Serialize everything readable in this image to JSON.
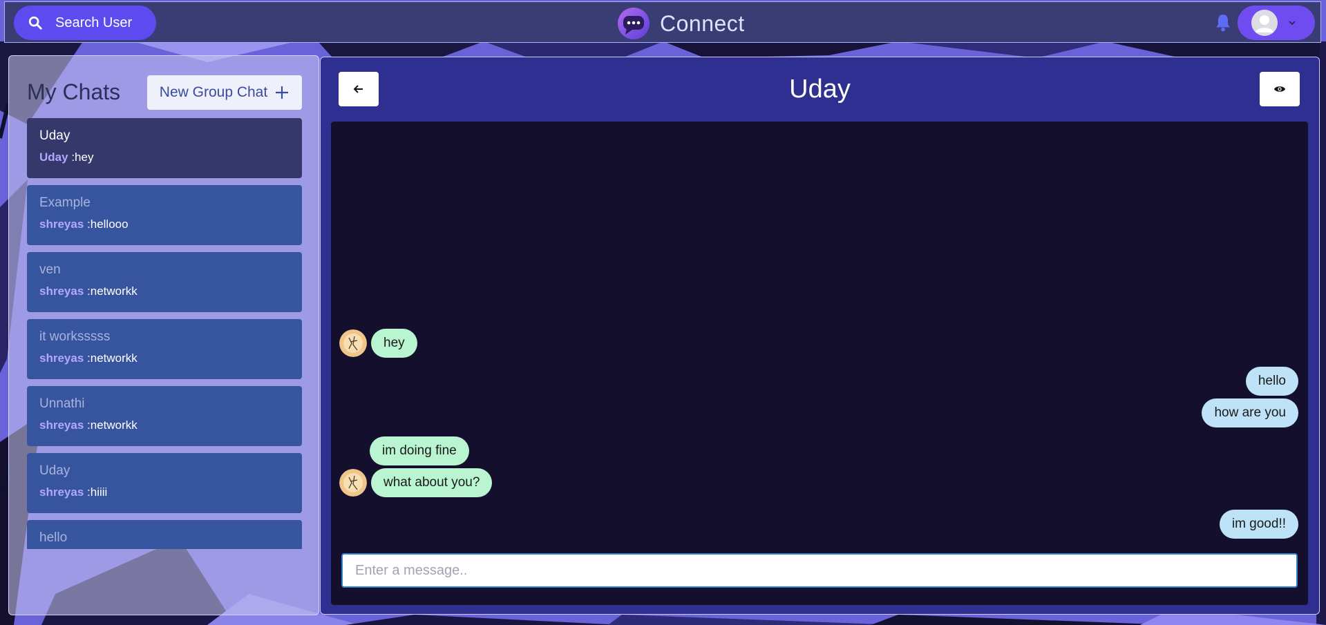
{
  "header": {
    "search_label": "Search User",
    "brand_name": "Connect"
  },
  "sidebar": {
    "title": "My Chats",
    "new_group_label": "New Group Chat",
    "chats": [
      {
        "name": "Uday",
        "sender": "Uday",
        "latest": ":hey",
        "active": true
      },
      {
        "name": "Example",
        "sender": "shreyas",
        "latest": ":hellooo",
        "active": false
      },
      {
        "name": "ven",
        "sender": "shreyas",
        "latest": ":networkk",
        "active": false
      },
      {
        "name": "it worksssss",
        "sender": "shreyas",
        "latest": ":networkk",
        "active": false
      },
      {
        "name": "Unnathi",
        "sender": "shreyas",
        "latest": ":networkk",
        "active": false
      },
      {
        "name": "Uday",
        "sender": "shreyas",
        "latest": ":hiiii",
        "active": false
      },
      {
        "name": "hello",
        "sender": "",
        "latest": "",
        "active": false
      }
    ]
  },
  "chat": {
    "title": "Uday",
    "messages": [
      {
        "text": "hey",
        "from": "them",
        "avatar": true
      },
      {
        "text": "hello",
        "from": "me",
        "avatar": false
      },
      {
        "text": "how are you",
        "from": "me",
        "avatar": false
      },
      {
        "text": "im doing fine",
        "from": "them",
        "avatar": false
      },
      {
        "text": "what about you?",
        "from": "them",
        "avatar": true
      },
      {
        "text": "im good!!",
        "from": "me",
        "avatar": false
      }
    ],
    "input_placeholder": "Enter a message.."
  },
  "colors": {
    "topbar": "#3a3d74",
    "accent": "#5d4bf0",
    "chat_panel": "#2f2f92",
    "messages_bg": "#150f2e",
    "bubble_them": "#b9f5d0",
    "bubble_me": "#bee3f8",
    "chat_item": "#37559e",
    "chat_item_active": "#34386a"
  },
  "icons": {
    "search": "search-icon",
    "logo": "chat-bubble-logo-icon",
    "bell": "bell-icon",
    "avatar": "user-avatar-icon",
    "chevron": "chevron-down-icon",
    "plus": "plus-icon",
    "back": "arrow-left-icon",
    "view": "eye-icon"
  }
}
